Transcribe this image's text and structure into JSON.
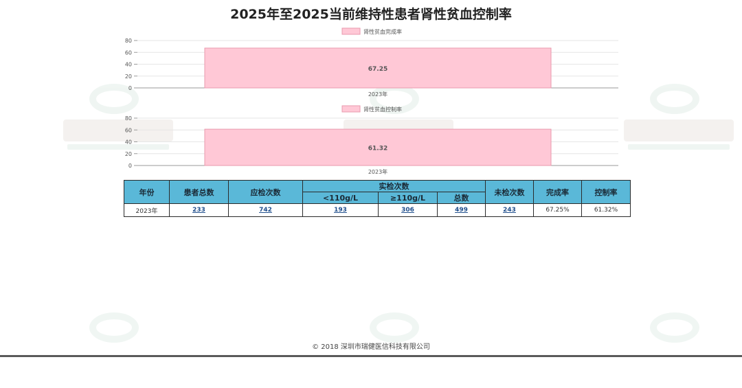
{
  "page": {
    "title": "2025年至2025当前维持性患者肾性贫血控制率",
    "footer": "© 2018 深圳市瑞健医信科技有限公司"
  },
  "colors": {
    "bar_fill": "#ffc8d6",
    "bar_stroke": "#e89aae",
    "header_bg": "#5ab8d8",
    "link": "#1f4e8c"
  },
  "chart_data": [
    {
      "type": "bar",
      "categories": [
        "2023年"
      ],
      "series": [
        {
          "name": "肾性贫血完成率",
          "values": [
            67.25
          ]
        }
      ],
      "ylim": [
        0,
        80
      ],
      "yticks": [
        0,
        20,
        40,
        60,
        80
      ],
      "data_labels": [
        "67.25"
      ],
      "legend": "top-center",
      "grid": true
    },
    {
      "type": "bar",
      "categories": [
        "2023年"
      ],
      "series": [
        {
          "name": "肾性贫血控制率",
          "values": [
            61.32
          ]
        }
      ],
      "ylim": [
        0,
        80
      ],
      "yticks": [
        0,
        20,
        40,
        60,
        80
      ],
      "data_labels": [
        "61.32"
      ],
      "legend": "top-center",
      "grid": true
    }
  ],
  "table": {
    "headers": {
      "year": "年份",
      "patients": "患者总数",
      "expected": "应检次数",
      "actual": "实检次数",
      "lt110": "<110g/L",
      "ge110": "≥110g/L",
      "total": "总数",
      "unchecked": "未检次数",
      "completion": "完成率",
      "control": "控制率"
    },
    "rows": [
      {
        "year": "2023年",
        "patients": "233",
        "expected": "742",
        "lt110": "193",
        "ge110": "306",
        "total": "499",
        "unchecked": "243",
        "completion": "67.25%",
        "control": "61.32%"
      }
    ]
  }
}
